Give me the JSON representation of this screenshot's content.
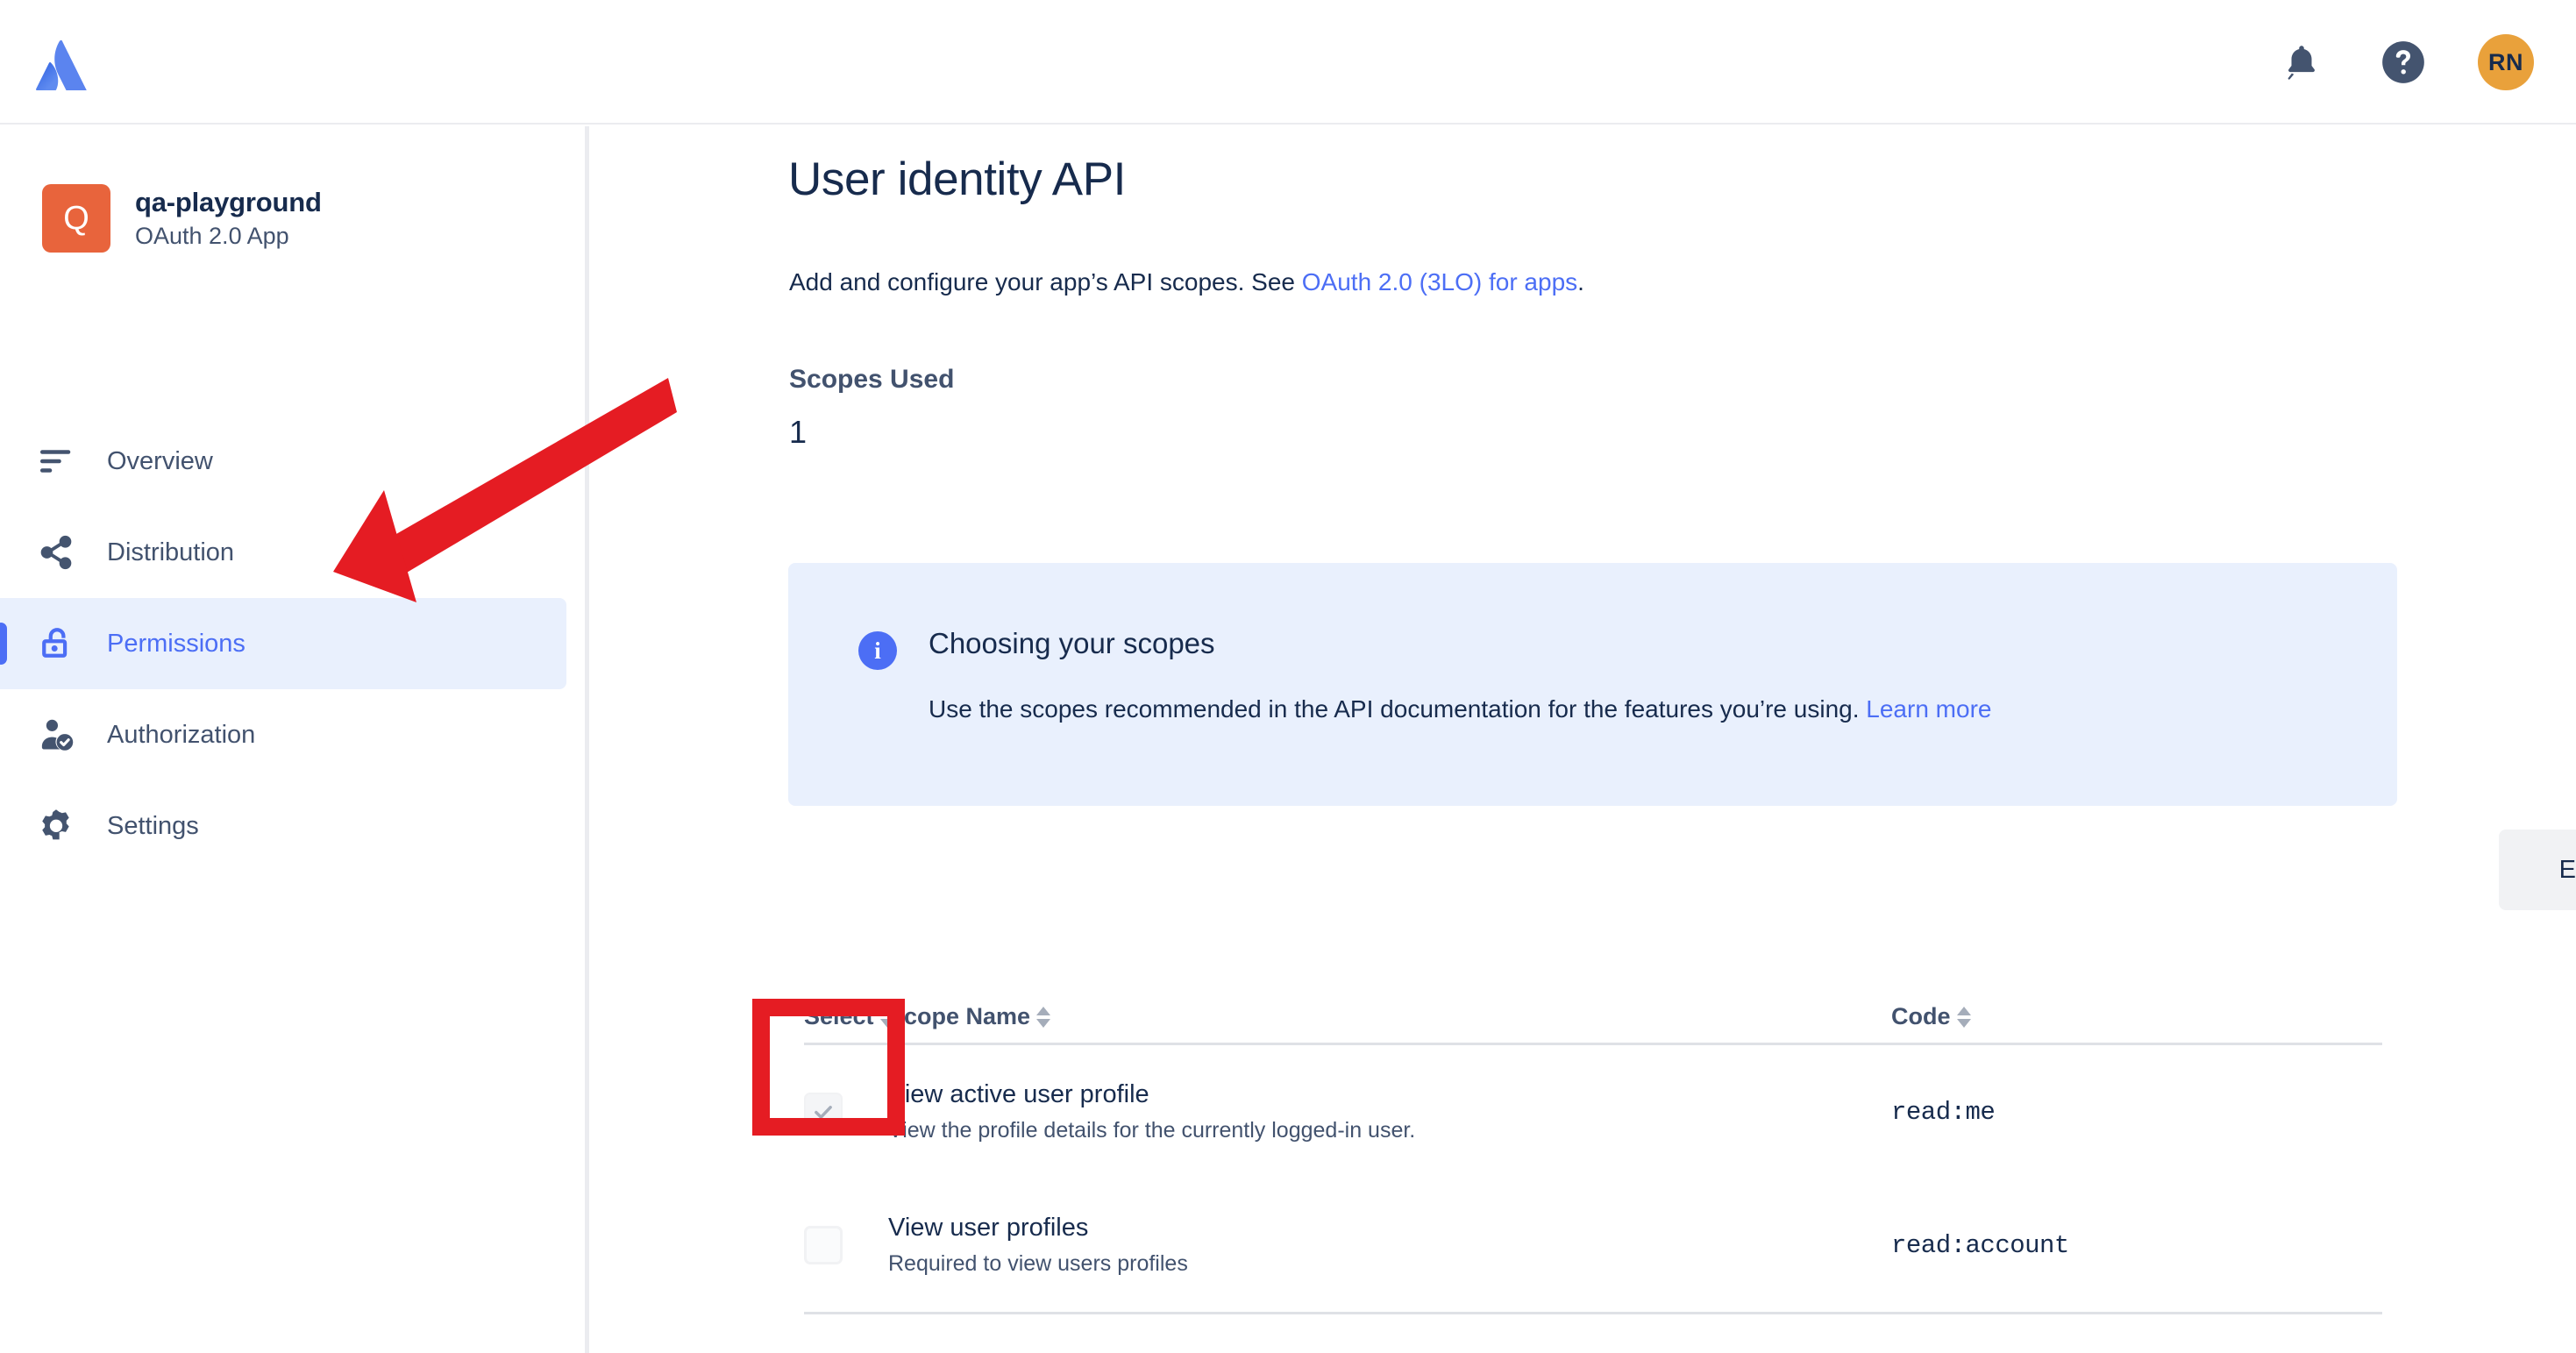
{
  "topbar": {
    "logo": "atlassian-logo",
    "notifications_icon": "bell-icon",
    "help_icon": "help-circle-icon",
    "avatar_initials": "RN"
  },
  "sidebar": {
    "app": {
      "avatar_letter": "Q",
      "name": "qa-playground",
      "type": "OAuth 2.0 App",
      "avatar_color": "#e8643c"
    },
    "items": [
      {
        "label": "Overview",
        "icon": "list-icon",
        "active": false
      },
      {
        "label": "Distribution",
        "icon": "share-icon",
        "active": false
      },
      {
        "label": "Permissions",
        "icon": "unlock-icon",
        "active": true
      },
      {
        "label": "Authorization",
        "icon": "person-check-icon",
        "active": false
      },
      {
        "label": "Settings",
        "icon": "gear-icon",
        "active": false
      }
    ],
    "active_color": "#4c6ef5",
    "active_background": "#e9f0fd"
  },
  "main": {
    "title": "User identity API",
    "description_prefix": "Add and configure your app’s API scopes. See ",
    "description_link": "OAuth 2.0 (3LO) for apps",
    "description_suffix": ".",
    "scopes_used_label": "Scopes Used",
    "scopes_used_count": "1",
    "banner": {
      "icon": "info-icon",
      "title": "Choosing your scopes",
      "body_prefix": "Use the scopes recommended in the API documentation for the features you’re using. ",
      "body_link": "Learn more",
      "background": "#e9f0fd",
      "accent": "#4c6ef5"
    },
    "edit_scopes_label": "Edit Scopes",
    "table": {
      "columns": [
        {
          "key": "select",
          "label": "Select",
          "sortable": true
        },
        {
          "key": "name",
          "label": "Scope Name",
          "sortable": true
        },
        {
          "key": "code",
          "label": "Code",
          "sortable": true
        }
      ],
      "rows": [
        {
          "checked": true,
          "disabled": true,
          "name": "View active user profile",
          "description": "View the profile details for the currently logged-in user.",
          "code": "read:me"
        },
        {
          "checked": false,
          "disabled": true,
          "name": "View user profiles",
          "description": "Required to view users profiles",
          "code": "read:account"
        }
      ]
    }
  },
  "annotations": {
    "arrow_color": "#e51c23",
    "highlight_color": "#e51c23",
    "arrow_target": "sidebar-item-permissions",
    "highlight_target": "scope-row-0-checkbox"
  }
}
